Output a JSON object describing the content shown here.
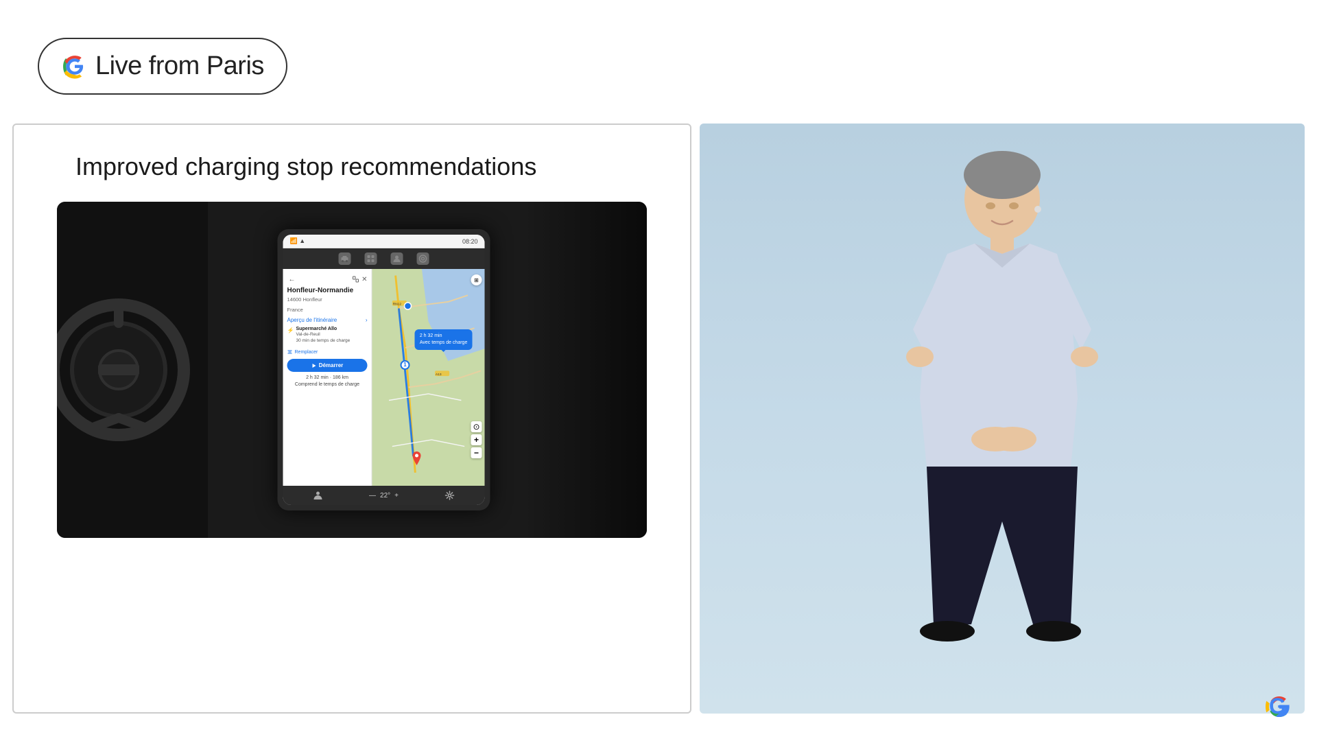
{
  "header": {
    "badge_text": "Live from Paris",
    "google_colors": [
      "#4285F4",
      "#EA4335",
      "#FBBC05",
      "#34A853"
    ]
  },
  "slide": {
    "title": "Improved charging stop recommendations",
    "map_content": {
      "destination_name": "Honfleur-Normandie",
      "destination_address_line1": "14600 Honfleur",
      "destination_address_line2": "France",
      "itinerary_label": "Aperçu de l'itinéraire",
      "charging_stop_name": "Supermarché Allo",
      "charging_stop_location": "Val-de-Reuil",
      "charging_stop_time": "30 min de temps de charge",
      "replace_label": "Remplacer",
      "start_button": "Démarrer",
      "route_time": "2 h 32 min · 186 km",
      "route_detail": "Comprend le temps de charge",
      "tooltip_line1": "2 h 32 min",
      "tooltip_line2": "Avec temps de charge",
      "temperature": "22°",
      "status_time": "08:20"
    }
  },
  "presenter": {
    "background_color": "#bed2de"
  },
  "google_logo": {
    "colors": {
      "blue": "#4285F4",
      "red": "#EA4335",
      "yellow": "#FBBC05",
      "green": "#34A853"
    }
  }
}
